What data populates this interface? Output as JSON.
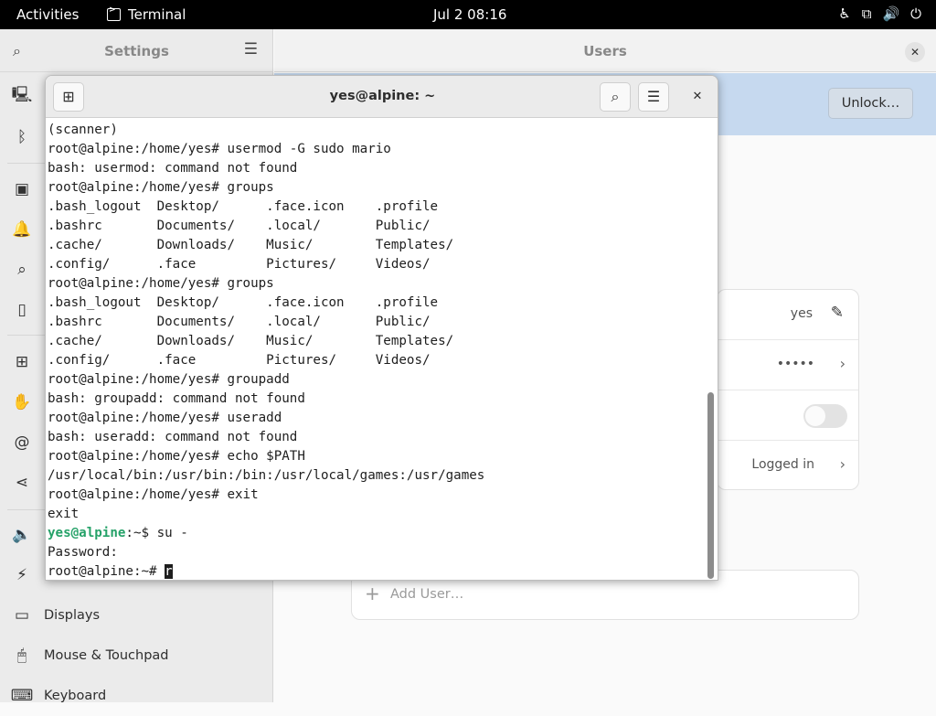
{
  "topbar": {
    "activities": "Activities",
    "app_name": "Terminal",
    "clock": "Jul 2  08:16",
    "tray_icons": [
      "accessibility-icon",
      "network-icon",
      "volume-icon",
      "power-icon"
    ]
  },
  "settings": {
    "sidebar_title": "Settings",
    "main_title": "Users",
    "unlock_label": "Unlock…",
    "sidebar_items": [
      {
        "icon": "network-icon",
        "label": ""
      },
      {
        "icon": "bluetooth-icon",
        "label": ""
      },
      {
        "icon": "background-icon",
        "label": ""
      },
      {
        "icon": "notifications-icon",
        "label": ""
      },
      {
        "icon": "search-icon",
        "label": ""
      },
      {
        "icon": "multitasking-icon",
        "label": ""
      },
      {
        "icon": "applications-icon",
        "label": ""
      },
      {
        "icon": "privacy-icon",
        "label": ""
      },
      {
        "icon": "online-accounts-icon",
        "label": ""
      },
      {
        "icon": "sharing-icon",
        "label": ""
      },
      {
        "icon": "sound-icon",
        "label": ""
      },
      {
        "icon": "power-icon",
        "label": ""
      },
      {
        "icon": "displays-icon",
        "label": "Displays"
      },
      {
        "icon": "mouse-icon",
        "label": "Mouse & Touchpad"
      },
      {
        "icon": "keyboard-icon",
        "label": "Keyboard"
      }
    ],
    "user_card": {
      "name_value": "yes",
      "password_value": "•••••",
      "auto_login_on": false,
      "activity_value": "Logged in"
    },
    "add_user_label": "Add User…"
  },
  "terminal": {
    "title": "yes@alpine: ~",
    "lines": [
      {
        "text": "(scanner)"
      },
      {
        "text": "root@alpine:/home/yes# usermod -G sudo mario"
      },
      {
        "text": "bash: usermod: command not found"
      },
      {
        "text": "root@alpine:/home/yes# groups"
      },
      {
        "text": ".bash_logout  Desktop/      .face.icon    .profile"
      },
      {
        "text": ".bashrc       Documents/    .local/       Public/"
      },
      {
        "text": ".cache/       Downloads/    Music/        Templates/"
      },
      {
        "text": ".config/      .face         Pictures/     Videos/"
      },
      {
        "text": "root@alpine:/home/yes# groups"
      },
      {
        "text": ".bash_logout  Desktop/      .face.icon    .profile"
      },
      {
        "text": ".bashrc       Documents/    .local/       Public/"
      },
      {
        "text": ".cache/       Downloads/    Music/        Templates/"
      },
      {
        "text": ".config/      .face         Pictures/     Videos/"
      },
      {
        "text": "root@alpine:/home/yes# groupadd"
      },
      {
        "text": "bash: groupadd: command not found"
      },
      {
        "text": "root@alpine:/home/yes# useradd"
      },
      {
        "text": "bash: useradd: command not found"
      },
      {
        "text": "root@alpine:/home/yes# echo $PATH"
      },
      {
        "text": "/usr/local/bin:/usr/bin:/bin:/usr/local/games:/usr/games"
      },
      {
        "text": "root@alpine:/home/yes# exit"
      },
      {
        "text": "exit"
      }
    ],
    "user_prompt": {
      "user_host": "yes@alpine",
      "rest": ":~$ su -"
    },
    "password_line": "Password:",
    "current_prompt": "root@alpine:~# ",
    "current_input": "r"
  }
}
